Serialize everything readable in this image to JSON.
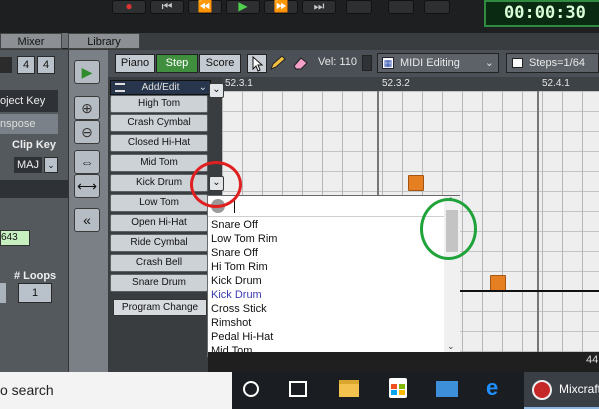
{
  "transport": {
    "buttons": [
      "●",
      "⏮",
      "⏪",
      "▶",
      "⏩",
      "⏭"
    ],
    "time": "00:00:30"
  },
  "left_tabs": {
    "mixer": "Mixer",
    "library": "Library"
  },
  "left_panel": {
    "time_sig_a": "4",
    "time_sig_b": "4",
    "project_key_label": "oject Key",
    "transpose_label": "nspose",
    "clip_key_label": "Clip Key",
    "clip_key_value": "MAJ",
    "tempo_value": "643",
    "loops_label": "# Loops",
    "loops_value": "1"
  },
  "editor_toolbar": {
    "views": [
      "Piano",
      "Step",
      "Score"
    ],
    "active_view": "Step",
    "velocity_label": "Vel: 110",
    "mode_select": "MIDI Editing",
    "steps_select": "Steps=1/64"
  },
  "ruler": {
    "marks": [
      "52.3.1",
      "52.3.2",
      "52.4.1"
    ]
  },
  "add_edit_label": "Add/Edit",
  "drum_rows": [
    "High Tom",
    "Crash Cymbal",
    "Closed Hi-Hat",
    "Mid Tom",
    "Kick Drum",
    "Low Tom",
    "Open Hi-Hat",
    "Ride Cymbal",
    "Crash Bell",
    "Snare Drum"
  ],
  "program_change": "Program Change",
  "dropdown": {
    "items": [
      "Snare Off",
      "Low Tom Rim",
      "Snare Off",
      "Hi Tom Rim",
      "Kick Drum",
      "Kick Drum",
      "Cross Stick",
      "Rimshot",
      "Pedal Hi-Hat",
      "Mid Tom"
    ],
    "selected_index": 5
  },
  "bottom_mark": "44",
  "taskbar": {
    "search_text": "o search",
    "app_label": "Mixcraft"
  },
  "colors": {
    "note": "#e67e22",
    "step_active": "#3f8f3f",
    "time_green": "#2e8b3f",
    "annotation_red": "#e02020",
    "annotation_green": "#1fa33a"
  }
}
